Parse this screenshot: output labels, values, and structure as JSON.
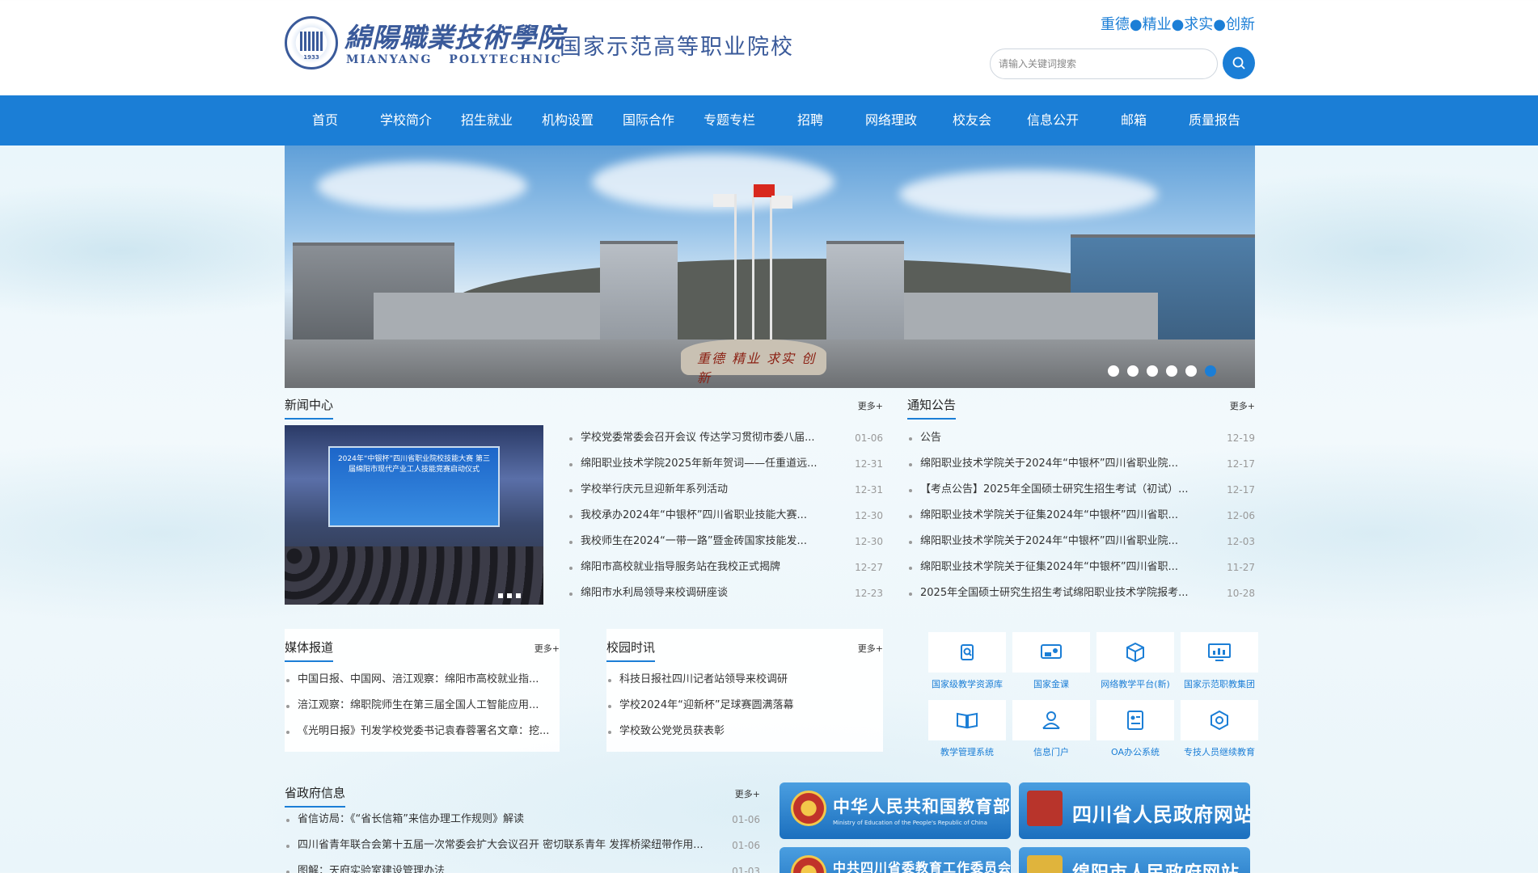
{
  "header": {
    "logo_cn": "綿陽職業技術學院",
    "logo_en": "MIANYANG POLYTECHNIC",
    "logo_year": "1933",
    "tagline": "国家示范高等职业院校",
    "motto": "重德●精业●求实●创新",
    "search_placeholder": "请输入关键词搜索"
  },
  "nav": [
    "首页",
    "学校简介",
    "招生就业",
    "机构设置",
    "国际合作",
    "专题专栏",
    "招聘",
    "网络理政",
    "校友会",
    "信息公开",
    "邮箱",
    "质量报告"
  ],
  "banner": {
    "rock_text": "重德 精业 求实 创新",
    "slide_count": 6,
    "active_slide": 6
  },
  "news": {
    "title": "新闻中心",
    "more": "更多+",
    "photo_text": "2024年“中银杯”四川省职业院校技能大赛 第三届绵阳市现代产业工人技能竞赛启动仪式",
    "items": [
      {
        "title": "学校党委常委会召开会议 传达学习贯彻市委八届...",
        "date": "01-06"
      },
      {
        "title": "绵阳职业技术学院2025年新年贺词——任重道远...",
        "date": "12-31"
      },
      {
        "title": "学校举行庆元旦迎新年系列活动",
        "date": "12-31"
      },
      {
        "title": "我校承办2024年“中银杯”四川省职业技能大赛...",
        "date": "12-30"
      },
      {
        "title": "我校师生在2024“一带一路”暨金砖国家技能发...",
        "date": "12-30"
      },
      {
        "title": "绵阳市高校就业指导服务站在我校正式揭牌",
        "date": "12-27"
      },
      {
        "title": "绵阳市水利局领导来校调研座谈",
        "date": "12-23"
      }
    ]
  },
  "notice": {
    "title": "通知公告",
    "more": "更多+",
    "items": [
      {
        "title": "公告",
        "date": "12-19"
      },
      {
        "title": "绵阳职业技术学院关于2024年“中银杯”四川省职业院...",
        "date": "12-17"
      },
      {
        "title": "【考点公告】2025年全国硕士研究生招生考试（初试）...",
        "date": "12-17"
      },
      {
        "title": "绵阳职业技术学院关于征集2024年“中银杯”四川省职...",
        "date": "12-06"
      },
      {
        "title": "绵阳职业技术学院关于2024年“中银杯”四川省职业院...",
        "date": "12-03"
      },
      {
        "title": "绵阳职业技术学院关于征集2024年“中银杯”四川省职...",
        "date": "11-27"
      },
      {
        "title": "2025年全国硕士研究生招生考试绵阳职业技术学院报考...",
        "date": "10-28"
      }
    ]
  },
  "media": {
    "title": "媒体报道",
    "more": "更多+",
    "items": [
      "中国日报、中国网、涪江观察：绵阳市高校就业指...",
      "涪江观察：绵职院师生在第三届全国人工智能应用...",
      "《光明日报》刊发学校党委书记袁春蓉署名文章：挖..."
    ]
  },
  "campus": {
    "title": "校园时讯",
    "more": "更多+",
    "items": [
      "科技日报社四川记者站领导来校调研",
      "学校2024年“迎新杯”足球赛圆满落幕",
      "学校致公党党员获表彰"
    ]
  },
  "quick_links": [
    {
      "label": "国家级教学资源库",
      "icon": "search-doc-icon"
    },
    {
      "label": "国家金课",
      "icon": "video-class-icon"
    },
    {
      "label": "网络教学平台(新)",
      "icon": "platform-cube-icon"
    },
    {
      "label": "国家示范职教集团",
      "icon": "monitor-chart-icon"
    },
    {
      "label": "教学管理系统",
      "icon": "open-book-icon"
    },
    {
      "label": "信息门户",
      "icon": "user-portal-icon"
    },
    {
      "label": "OA办公系统",
      "icon": "id-card-icon"
    },
    {
      "label": "专技人员继续教育",
      "icon": "hexagon-icon"
    }
  ],
  "province": {
    "title": "省政府信息",
    "more": "更多+",
    "items": [
      {
        "title": "省信访局：《“省长信箱”来信办理工作规则》解读",
        "date": "01-06"
      },
      {
        "title": "四川省青年联合会第十五届一次常委会扩大会议召开 密切联系青年 发挥桥梁纽带作用...",
        "date": "01-06"
      },
      {
        "title": "图解：天府实验室建设管理办法",
        "date": "01-03"
      }
    ]
  },
  "gov_links": [
    {
      "name": "中华人民共和国教育部",
      "sub": "Ministry of Education of the People's Republic of China"
    },
    {
      "name": "四川省人民政府网站",
      "sub": ""
    },
    {
      "name": "中共四川省委教育工作委员会",
      "sub": ""
    },
    {
      "name": "绵阳市人民政府网站",
      "sub": ""
    }
  ],
  "colors": {
    "primary": "#1b7ed6",
    "logo": "#3a5a9a"
  }
}
